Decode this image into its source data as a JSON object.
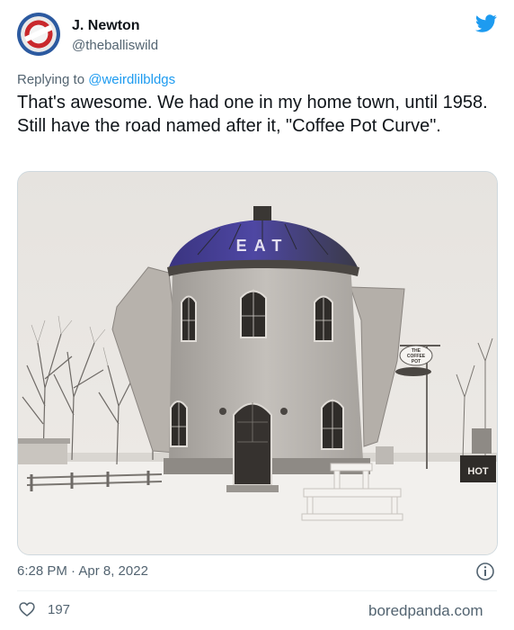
{
  "tweet": {
    "author_name": "J. Newton",
    "author_handle": "@theballiswild",
    "reply_prefix": "Replying to",
    "reply_handle": "@weirdlilbldgs",
    "text": "That's awesome. We had one in my home town, until 1958. Still have the road named after it, \"Coffee Pot Curve\".",
    "timestamp": "6:28 PM · Apr 8, 2022",
    "like_count": "197"
  },
  "photo": {
    "roof_sign": "EAT",
    "hanging_sign_line1": "THE",
    "hanging_sign_line2": "COFFEE",
    "hanging_sign_line3": "POT",
    "road_sign": "HOT"
  },
  "footer": {
    "source": "boredpanda.com"
  },
  "icons": {
    "brand": "twitter-bird-icon",
    "info": "info-icon",
    "like": "heart-icon"
  },
  "colors": {
    "twitter_blue": "#1d9bf0",
    "muted_text": "#536471",
    "text": "#0f1419"
  }
}
